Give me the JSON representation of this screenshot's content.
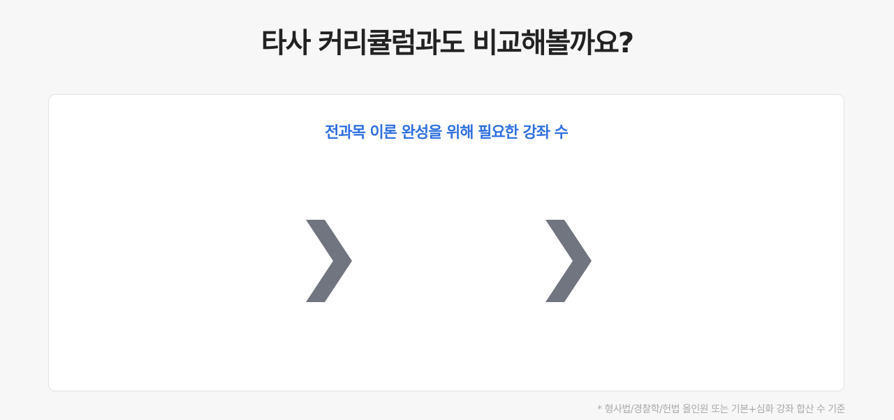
{
  "header": {
    "title": "타사 커리큘럼과도 비교해볼까요?"
  },
  "card": {
    "subtitle": "전과목 이론 완성을 위해 필요한 강좌 수",
    "arrows": [
      {
        "icon": "chevron-right-icon"
      },
      {
        "icon": "chevron-right-icon"
      }
    ]
  },
  "footnote": {
    "text": "* 형사법/경찰학/헌법 올인원 또는 기본+심화 강좌 합산 수 기준"
  },
  "colors": {
    "background": "#f7f7f7",
    "card": "#ffffff",
    "accent": "#2f6fe0",
    "chevron": "#71757f",
    "footnote": "#aaaaaa"
  }
}
